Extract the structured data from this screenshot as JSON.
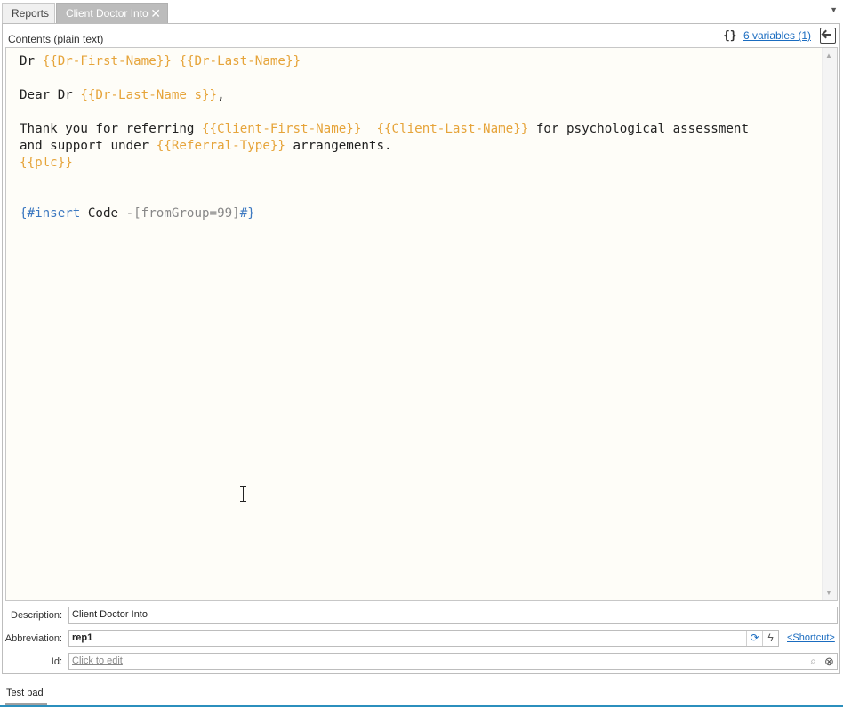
{
  "tabs": [
    {
      "label": "Reports",
      "active": false
    },
    {
      "label": "Client Doctor Into",
      "active": true,
      "close_glyph": "✕"
    }
  ],
  "tab_menu_glyph": "▼",
  "contents_label": "Contents (plain text)",
  "variables": {
    "brace": "{}",
    "link": "6 variables (1)"
  },
  "editor": {
    "line1": {
      "t1": "Dr ",
      "v1": "{{Dr-First-Name}}",
      "t2": " ",
      "v2": "{{Dr-Last-Name}}"
    },
    "line2": {
      "t1": "Dear Dr ",
      "v1": "{{Dr-Last-Name s}}",
      "t2": ","
    },
    "line3": {
      "t1": "Thank you for referring ",
      "v1": "{{Client-First-Name}}",
      "t2": "  ",
      "v2": "{{Client-Last-Name}}",
      "t3": " for psychological assessment"
    },
    "line4": {
      "t1": "and support under ",
      "v1": "{{Referral-Type}}",
      "t2": " arrangements."
    },
    "line5": {
      "v1": "{{plc}}"
    },
    "line6": {
      "k1": "{#insert",
      "t1": " Code ",
      "g1": "-[fromGroup=99]",
      "k2": "#}"
    }
  },
  "fields": {
    "description": {
      "label": "Description:",
      "value": "Client Doctor Into"
    },
    "abbreviation": {
      "label": "Abbreviation:",
      "value": "rep1",
      "shortcut": "<Shortcut>"
    },
    "id": {
      "label": "Id:",
      "placeholder": "Click to edit"
    }
  },
  "test_pad": "Test pad",
  "icons": {
    "refresh": "refresh-icon",
    "bolt": "lightning-icon",
    "search": "search-icon",
    "clear": "clear-icon",
    "insert": "insert-variable-icon"
  }
}
